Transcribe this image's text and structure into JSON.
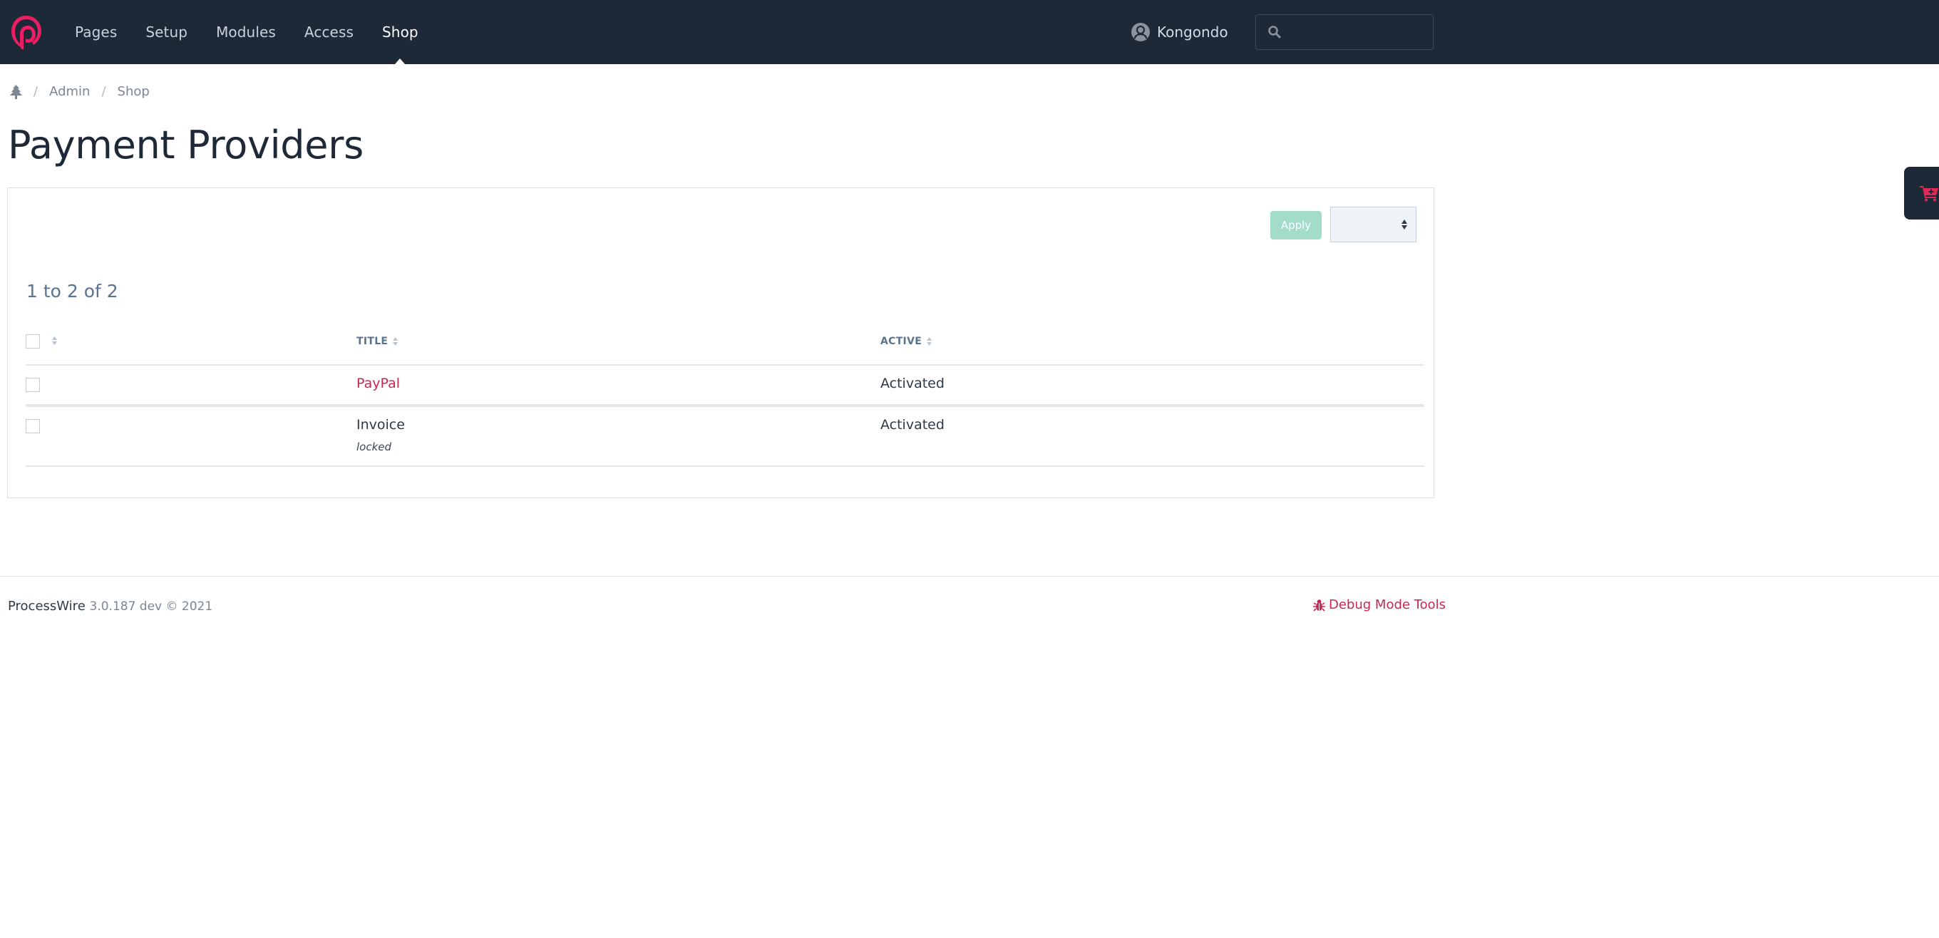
{
  "masthead": {
    "nav": [
      {
        "label": "Pages",
        "active": false
      },
      {
        "label": "Setup",
        "active": false
      },
      {
        "label": "Modules",
        "active": false
      },
      {
        "label": "Access",
        "active": false
      },
      {
        "label": "Shop",
        "active": true
      }
    ],
    "user": {
      "name": "Kongondo",
      "icon": "user-circle-icon"
    },
    "search": {
      "placeholder": "",
      "value": "",
      "icon": "search-icon"
    },
    "logo_icon": "processwire-logo-icon"
  },
  "breadcrumb": {
    "home_icon": "tree-icon",
    "items": [
      "Admin",
      "Shop"
    ],
    "separator": "/"
  },
  "page_title": "Payment Providers",
  "panel": {
    "apply_label": "Apply",
    "action_select": {
      "selected": ""
    },
    "count_text": "1 to 2 of 2",
    "table": {
      "columns": [
        {
          "label": "",
          "sortable": true
        },
        {
          "label": "TITLE",
          "sortable": true
        },
        {
          "label": "ACTIVE",
          "sortable": true
        }
      ],
      "rows": [
        {
          "title": "PayPal",
          "title_is_link": true,
          "note": "",
          "active": "Activated"
        },
        {
          "title": "Invoice",
          "title_is_link": false,
          "note": "locked",
          "active": "Activated"
        }
      ]
    }
  },
  "footer": {
    "brand": "ProcessWire",
    "version": "3.0.187 dev © 2021",
    "debug_label": "Debug Mode Tools",
    "debug_icon": "bug-icon"
  },
  "cart_tab": {
    "icon": "cart-plus-icon"
  },
  "colors": {
    "masthead_bg": "#1e2937",
    "accent": "#c7284f",
    "apply_bg": "#a3dccb",
    "muted_blue": "#5a7390"
  }
}
